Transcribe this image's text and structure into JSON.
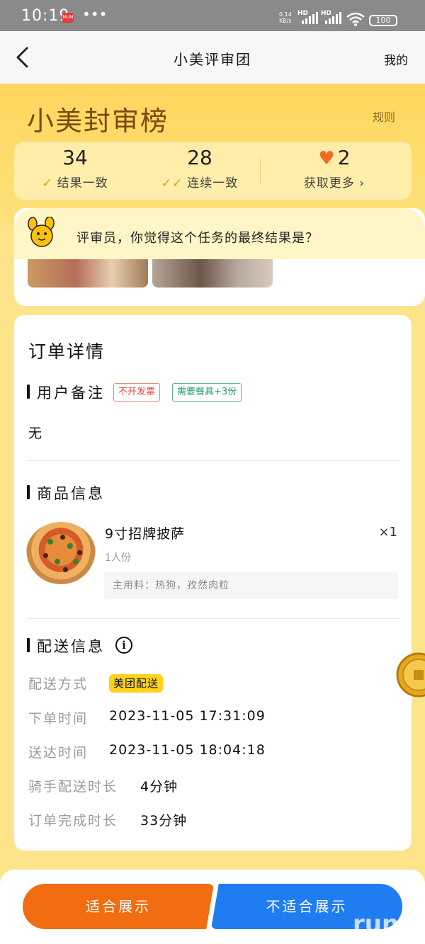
{
  "status_bar": {
    "time": "10:19",
    "app_badge": "MUM",
    "dots": "•••",
    "net_speed": "0.14",
    "net_unit": "KB/s",
    "hd1": "HD",
    "hd2": "HD",
    "battery": "100"
  },
  "navbar": {
    "back_icon": "chevron-left-icon",
    "title": "小美评审团",
    "mine": "我的"
  },
  "header": {
    "brand": "小美封审榜",
    "rules": "规则"
  },
  "stats": [
    {
      "value": "34",
      "label": "结果一致",
      "icon": "check-icon"
    },
    {
      "value": "28",
      "label": "连续一致",
      "icon": "double-check-icon"
    },
    {
      "value": "2",
      "label": "获取更多",
      "icon": "heart-icon",
      "suffix": "›"
    }
  ],
  "question": {
    "text": "评审员，你觉得这个任务的最终结果是？"
  },
  "order": {
    "title": "订单详情",
    "remark": {
      "heading": "用户备注",
      "tags": [
        "不开发票",
        "需要餐具+3份"
      ],
      "value": "无"
    },
    "goods": {
      "heading": "商品信息",
      "name": "9寸招牌披萨",
      "qty": "×1",
      "serving": "1人份",
      "ingredients": "主用料：热狗，孜然肉粒"
    },
    "delivery": {
      "heading": "配送信息",
      "info_icon": "info-icon",
      "rows": [
        {
          "label": "配送方式",
          "value": "美团配送"
        },
        {
          "label": "下单时间",
          "value": "2023-11-05 17:31:09"
        },
        {
          "label": "送达时间",
          "value": "2023-11-05 18:04:18"
        },
        {
          "label": "骑手配送时长",
          "value": "4分钟"
        },
        {
          "label": "订单完成时长",
          "value": "33分钟"
        }
      ]
    }
  },
  "actions": {
    "suitable": "适合展示",
    "unsuitable": "不适合展示"
  },
  "watermark": "run",
  "colors": {
    "accent_orange": "#f26c12",
    "accent_blue": "#1f7df1",
    "brand_yellow": "#fed65d"
  }
}
